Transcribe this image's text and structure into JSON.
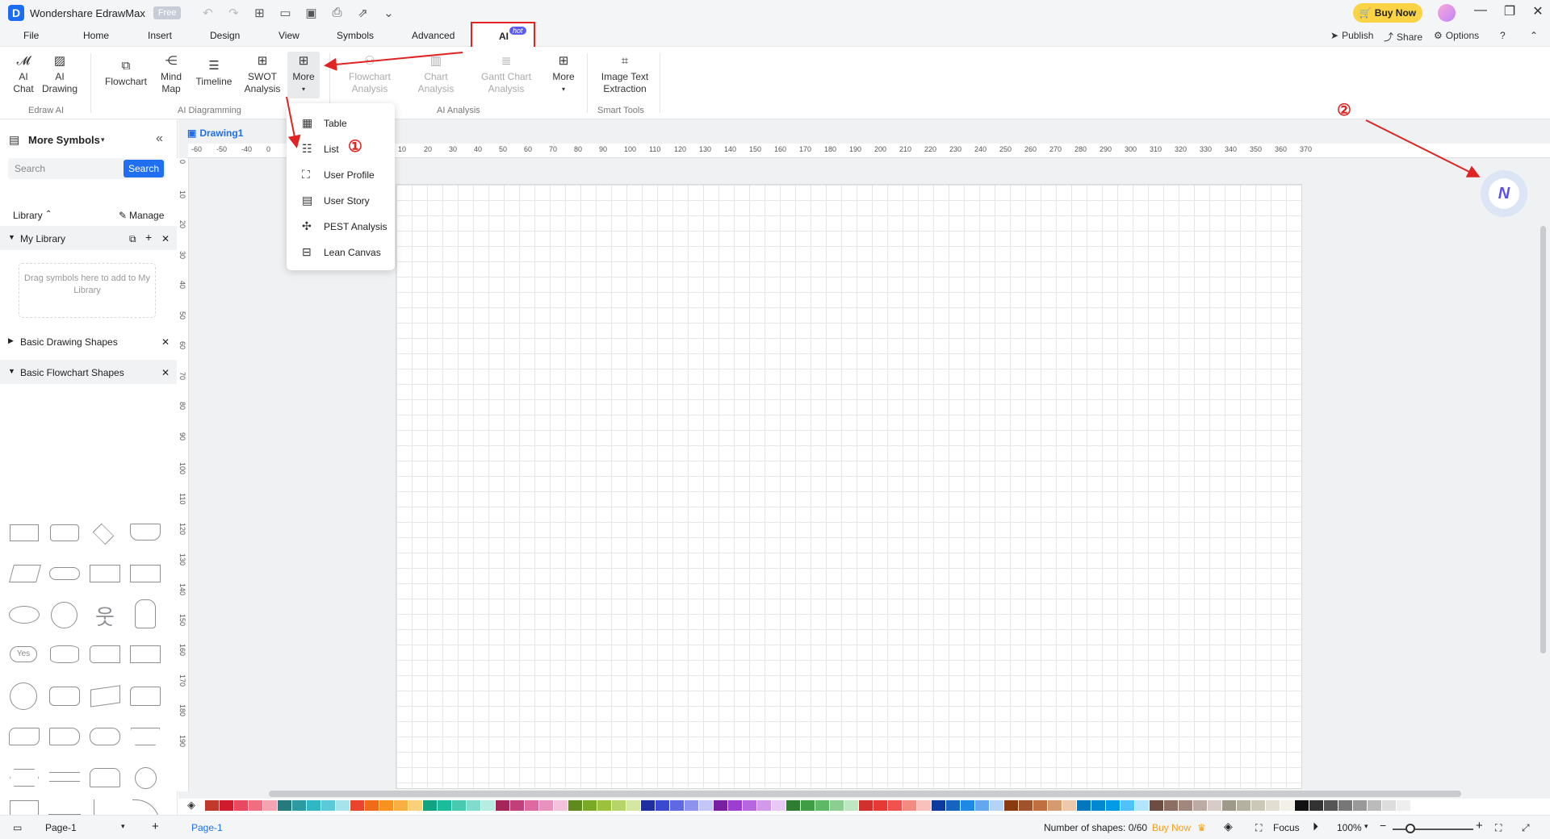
{
  "app": {
    "title": "Wondershare EdrawMax",
    "badge": "Free",
    "buy_now": "Buy Now"
  },
  "menubar": {
    "items": [
      "File",
      "Home",
      "Insert",
      "Design",
      "View",
      "Symbols",
      "Advanced"
    ],
    "ai_tab": "AI",
    "ai_badge": "hot",
    "right": {
      "publish": "Publish",
      "share": "Share",
      "options": "Options"
    }
  },
  "ribbon": {
    "edraw_ai": {
      "label": "Edraw AI",
      "ai_chat": "AI\nChat",
      "ai_drawing": "AI\nDrawing"
    },
    "ai_diagramming": {
      "label": "AI Diagramming",
      "flowchart": "Flowchart",
      "mind_map": "Mind\nMap",
      "timeline": "Timeline",
      "swot": "SWOT\nAnalysis",
      "more": "More"
    },
    "ai_analysis": {
      "label": "AI Analysis",
      "flowchart_analysis": "Flowchart\nAnalysis",
      "chart_analysis": "Chart\nAnalysis",
      "gantt_analysis": "Gantt Chart\nAnalysis",
      "more": "More"
    },
    "smart_tools": {
      "label": "Smart Tools",
      "image_text": "Image Text\nExtraction"
    }
  },
  "dropdown": {
    "items": [
      "Table",
      "List",
      "User Profile",
      "User Story",
      "PEST Analysis",
      "Lean Canvas"
    ]
  },
  "annotations": {
    "one": "①",
    "two": "②"
  },
  "sidebar": {
    "title": "More Symbols",
    "search_placeholder": "Search",
    "search_btn": "Search",
    "library": "Library",
    "manage": "Manage",
    "my_library": "My Library",
    "drop_hint": "Drag symbols here to add to My Library",
    "basic_drawing": "Basic Drawing Shapes",
    "basic_flowchart": "Basic Flowchart Shapes",
    "yes_label": "Yes"
  },
  "document": {
    "tab": "Drawing1"
  },
  "ruler": {
    "h": [
      "-60",
      "-50",
      "-40",
      "0",
      "10",
      "20",
      "30",
      "40",
      "50",
      "60",
      "70",
      "80",
      "90",
      "100",
      "110",
      "120",
      "130",
      "140",
      "150",
      "160",
      "170",
      "180",
      "190",
      "200",
      "210",
      "220",
      "230",
      "240",
      "250",
      "260",
      "270",
      "280",
      "290",
      "300",
      "310",
      "320",
      "330",
      "340",
      "350",
      "360",
      "370"
    ],
    "v": [
      "0",
      "10",
      "20",
      "30",
      "40",
      "50",
      "60",
      "70",
      "80",
      "90",
      "100",
      "110",
      "120",
      "130",
      "140",
      "150",
      "160",
      "170",
      "180",
      "190"
    ]
  },
  "palette": [
    "#c0392b",
    "#d01b2e",
    "#e84860",
    "#ef6f80",
    "#f4a3b0",
    "#257a7e",
    "#2b9ba1",
    "#2fb7c3",
    "#5cc9d6",
    "#a6e3ea",
    "#e8452c",
    "#ef6b1a",
    "#f7921e",
    "#f9b043",
    "#fbd07a",
    "#10a37f",
    "#1bbc9b",
    "#48c9b0",
    "#80dccb",
    "#b7ece1",
    "#a6265a",
    "#c2407a",
    "#dc6aa0",
    "#e893bd",
    "#f3c3dc",
    "#5e8a1e",
    "#7aa928",
    "#9bc13d",
    "#b7d46a",
    "#d6e6a3",
    "#1f2fa1",
    "#3b49d1",
    "#6068e3",
    "#8d92ee",
    "#c3c6f6",
    "#7b1fa2",
    "#9c3fd0",
    "#b866e0",
    "#d19ae9",
    "#e8c8f4",
    "#2e7d32",
    "#3f9d45",
    "#5fb866",
    "#8cce90",
    "#c0e5c2",
    "#d32f2f",
    "#e53935",
    "#ef5350",
    "#f28b82",
    "#f8c1bc",
    "#0d3a9e",
    "#1565c0",
    "#1e88e5",
    "#64a7ee",
    "#b3d4f7",
    "#8b3a10",
    "#a0522d",
    "#c07040",
    "#d69a70",
    "#ebc9aa",
    "#0277bd",
    "#0288d1",
    "#039be5",
    "#4fc3f7",
    "#b3e5fc",
    "#6d4c41",
    "#8d6e63",
    "#a1887f",
    "#bcaaa4",
    "#d7ccc8",
    "#9e9a8a",
    "#b5b1a0",
    "#ccc8b8",
    "#e2dfd2",
    "#f2f0e8",
    "#111111",
    "#333333",
    "#555555",
    "#777777",
    "#999999",
    "#bbbbbb",
    "#dddddd",
    "#eeeeee"
  ],
  "status": {
    "page_select": "Page-1",
    "page_tab": "Page-1",
    "shapes_count": "Number of shapes: 0/60",
    "buy_now": "Buy Now",
    "focus": "Focus",
    "zoom": "100%"
  }
}
